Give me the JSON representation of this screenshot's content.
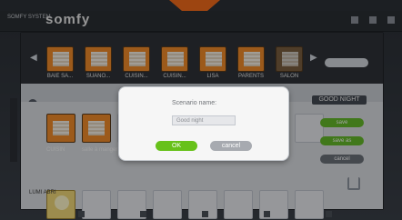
{
  "topbar": {
    "brand_small": "SOMFY SYSTEM",
    "logo": "somfy"
  },
  "devices": [
    {
      "label": "BAIE SA..."
    },
    {
      "label": "SUANO..."
    },
    {
      "label": "CUISIN..."
    },
    {
      "label": "CUISIN..."
    },
    {
      "label": "LISA"
    },
    {
      "label": "PARENTS"
    },
    {
      "label": "SALON"
    }
  ],
  "scenario": {
    "labels": [
      "CUISIN",
      "salle à manger"
    ],
    "light_label": "LUMI ABRI"
  },
  "right_panel": {
    "title": "GOOD NIGHT",
    "buttons": [
      "save",
      "save as",
      "cancel"
    ]
  },
  "dialog": {
    "label": "Scenario name:",
    "value": "Good night",
    "ok": "OK",
    "cancel": "cancel"
  }
}
